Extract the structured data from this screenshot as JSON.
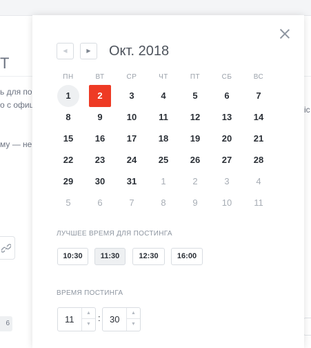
{
  "background": {
    "title_fragment": "Т",
    "text_line1": "ь для по",
    "text_line2": "о с офиц",
    "text_line3": "му — не б",
    "right_text": "ic",
    "chip_text": "6"
  },
  "calendar": {
    "prev_icon": "◀",
    "next_icon": "▶",
    "month_label": "Окт. 2018",
    "weekdays": [
      "ПН",
      "ВТ",
      "СР",
      "ЧТ",
      "ПТ",
      "СБ",
      "ВС"
    ],
    "weeks": [
      [
        "1",
        "2",
        "3",
        "4",
        "5",
        "6",
        "7"
      ],
      [
        "8",
        "9",
        "10",
        "11",
        "12",
        "13",
        "14"
      ],
      [
        "15",
        "16",
        "17",
        "18",
        "19",
        "20",
        "21"
      ],
      [
        "22",
        "23",
        "24",
        "25",
        "26",
        "27",
        "28"
      ],
      [
        "29",
        "30",
        "31",
        "1",
        "2",
        "3",
        "4"
      ],
      [
        "5",
        "6",
        "7",
        "8",
        "9",
        "10",
        "11"
      ]
    ],
    "today": "1",
    "selected": "2",
    "selected_color": "#ee3a24"
  },
  "best_time": {
    "label": "Лучшее время для постинга",
    "slots": [
      "10:30",
      "11:30",
      "12:30",
      "16:00"
    ],
    "active_slot": "11:30"
  },
  "post_time": {
    "label": "Время постинга",
    "hours": "11",
    "minutes": "30",
    "separator": ":",
    "up_icon": "▲",
    "down_icon": "▼"
  }
}
